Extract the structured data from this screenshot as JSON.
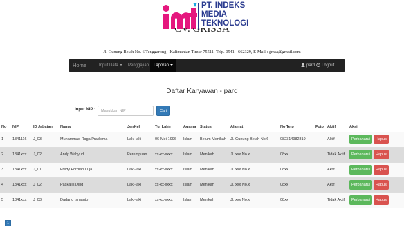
{
  "logo": {
    "line1": "PT. INDEKS",
    "line2": "MEDIA",
    "line3": "TEKNOLOGI",
    "colors": {
      "pink": "#e5177e",
      "dark": "#2a3b8f",
      "cyan": "#1ba6e0"
    }
  },
  "company": {
    "name": "CV. GRISSA",
    "address": "Jl. Gunung Belah No. 6 Tenggarong - Kalimantan Timur 75511, Telp. 0541 - 662329, E-Mail : gmsa@gmail.com"
  },
  "navbar": {
    "brand": "Home",
    "items": [
      "Input Data",
      "Penggajian",
      "Laporan"
    ],
    "user": "pard",
    "logout": "Logout"
  },
  "page": {
    "title": "Daftar Karyawan - pard"
  },
  "search": {
    "label": "Input NIP :",
    "placeholder": "Masukkan NIP",
    "button": "Cari"
  },
  "table": {
    "headers": [
      "No",
      "NIP",
      "ID Jabatan",
      "Nama",
      "JenKel",
      "Tgl Lahir",
      "Agama",
      "Status",
      "Alamat",
      "No Telp",
      "Foto",
      "Aktif",
      "Aksi"
    ],
    "rows": [
      [
        "1",
        "1341116",
        "J_03",
        "Muhammad Raga Pradisma",
        "Laki-laki",
        "06-Mei-1996",
        "Islam",
        "Belum Menikah",
        "Jl. Gunung Belah No 6",
        "082314982319",
        "",
        "Aktif"
      ],
      [
        "2",
        "1341xxx",
        "J_02",
        "Andy Wahyudi",
        "Perempuan",
        "xx-xx-xxxx",
        "Islam",
        "Menikah",
        "Jl. xxx No.x",
        "08xx",
        "",
        "Tidak Aktif"
      ],
      [
        "3",
        "1341xxx",
        "J_01",
        "Fredy Fordian Luja",
        "Laki-laki",
        "xx-xx-xxxx",
        "Islam",
        "Menikah",
        "Jl. xxx No.x",
        "08xx",
        "",
        "Aktif"
      ],
      [
        "4",
        "1341xxx",
        "J_02",
        "Paskalis Ding",
        "Laki-laki",
        "xx-xx-xxxx",
        "Islam",
        "Menikah",
        "Jl. xxx No.x",
        "08xx",
        "",
        "Aktif"
      ],
      [
        "5",
        "1341xxx",
        "J_03",
        "Dadang Ismanto",
        "Laki-laki",
        "xx-xx-xxxx",
        "Islam",
        "Menikah",
        "Jl. xxx No.x",
        "08xx",
        "",
        "Tidak Aktif"
      ]
    ],
    "actions": {
      "update": "Perbaharui",
      "delete": "Hapus"
    }
  },
  "pagination": {
    "current": "1"
  },
  "colors": {
    "navbar": "#222222",
    "primary": "#337ab7",
    "success": "#5cb85c",
    "danger": "#d9534f",
    "stripe": "#dcdcdc"
  }
}
